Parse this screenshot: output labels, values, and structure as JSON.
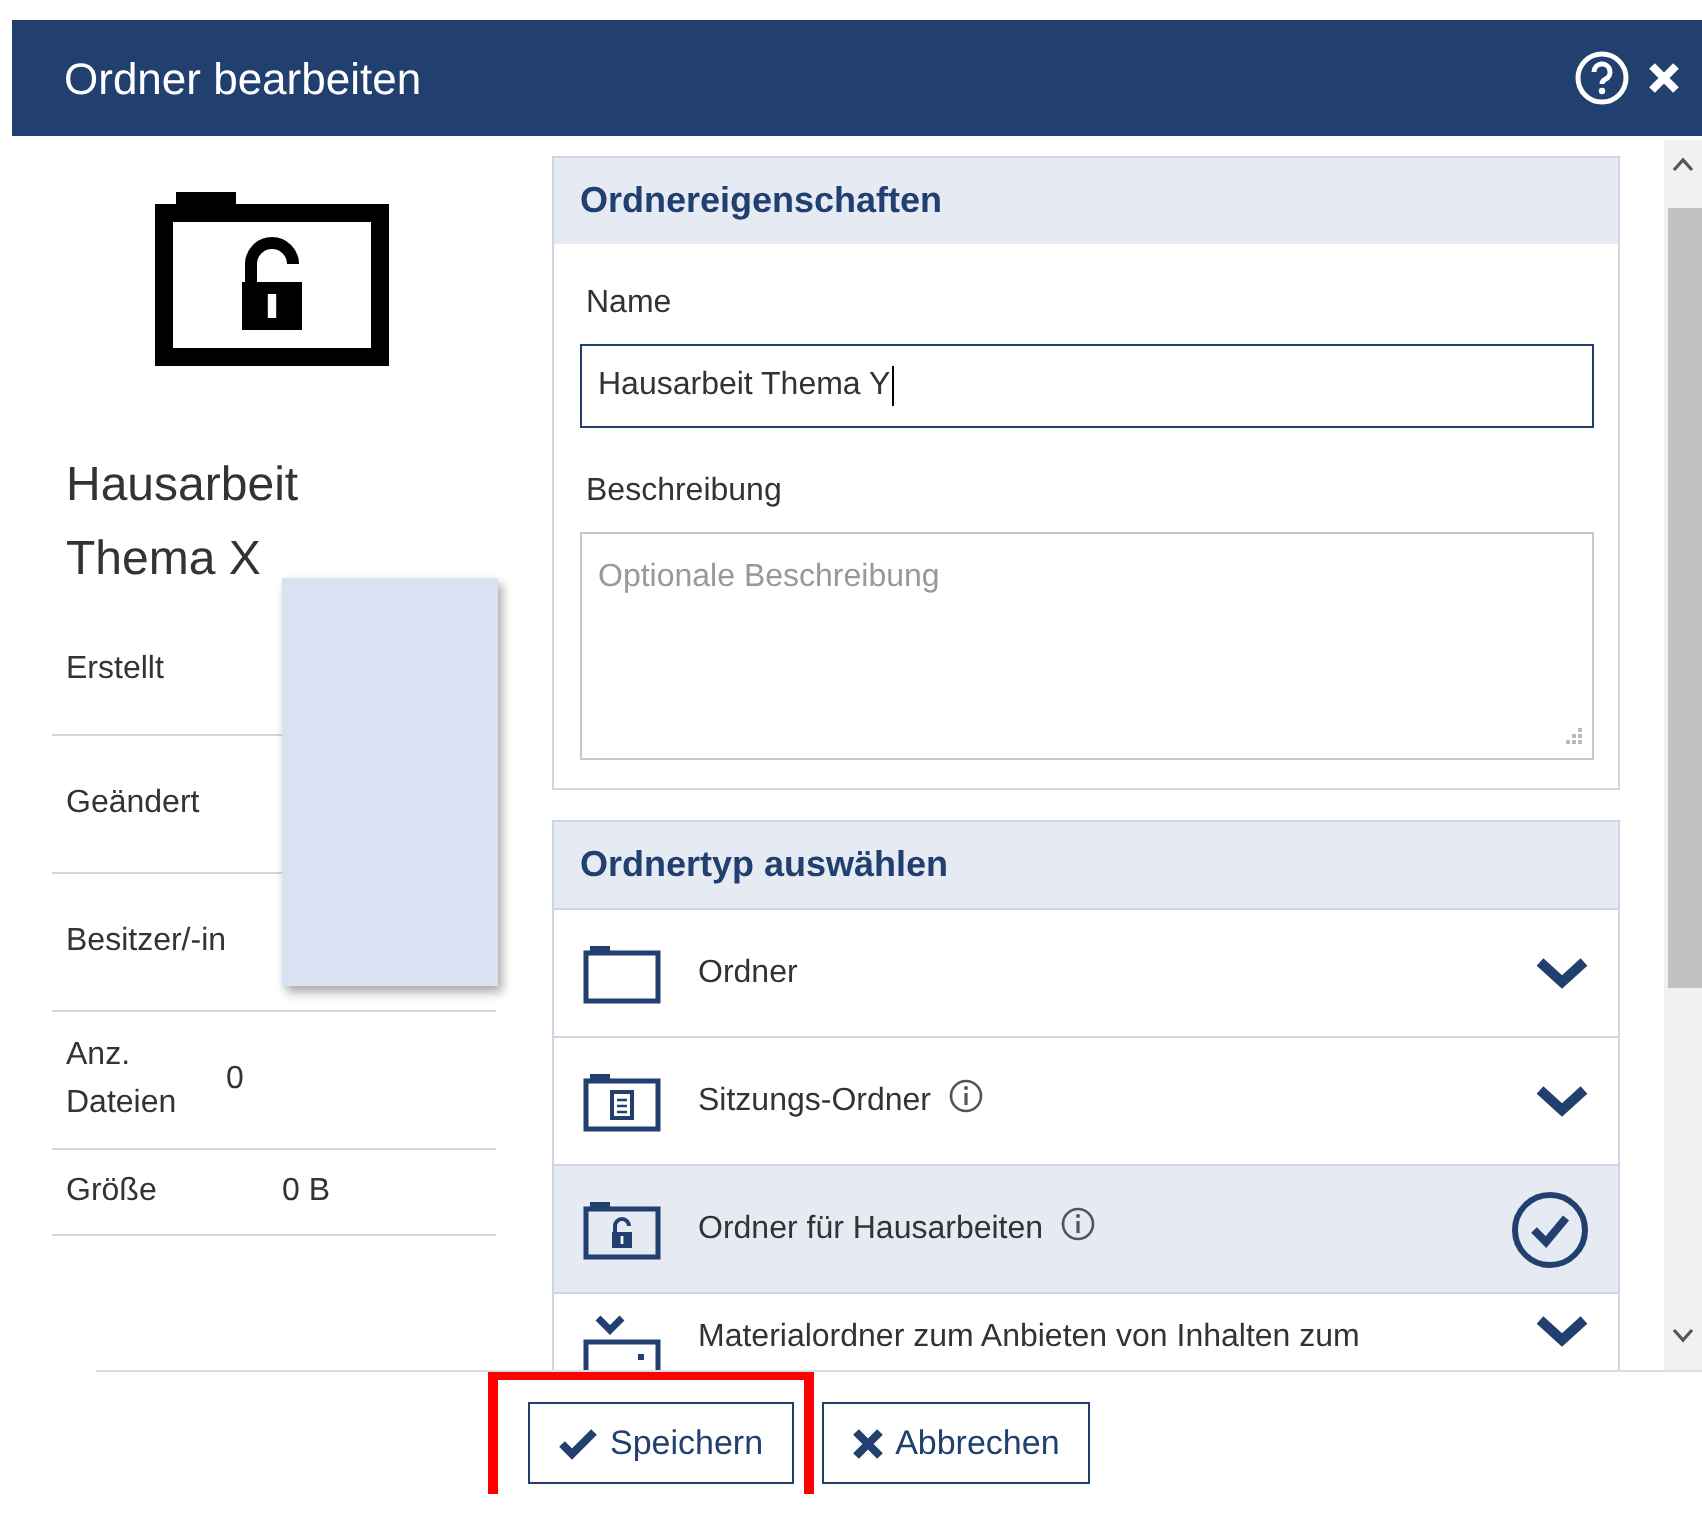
{
  "window": {
    "title": "Ordner bearbeiten"
  },
  "folder": {
    "name": "Hausarbeit Thema X"
  },
  "details": [
    {
      "label": "Erstellt",
      "redacted": true
    },
    {
      "label": "Geändert",
      "redacted": true
    },
    {
      "label": "Besitzer/-in",
      "redacted": true
    },
    {
      "label": "Anz. Dateien",
      "value": "0"
    },
    {
      "label": "Größe",
      "value": "0 B"
    }
  ],
  "properties": {
    "title": "Ordnereigenschaften",
    "name_label": "Name",
    "name_value": "Hausarbeit Thema Y",
    "description_label": "Beschreibung",
    "description_placeholder": "Optionale Beschreibung"
  },
  "folder_types": {
    "title": "Ordnertyp auswählen",
    "items": [
      {
        "label": "Ordner",
        "kind": "plain",
        "info": false,
        "selected": false
      },
      {
        "label": "Sitzungs-Ordner",
        "kind": "meeting",
        "info": true,
        "selected": false
      },
      {
        "label": "Ordner für Hausarbeiten",
        "kind": "locked",
        "info": true,
        "selected": true
      },
      {
        "label": "Materialordner zum Anbieten von Inhalten zum",
        "kind": "material",
        "info": false,
        "selected": false
      }
    ]
  },
  "buttons": [
    {
      "label": "Speichern",
      "kind": "save",
      "highlighted": true
    },
    {
      "label": "Abbrechen",
      "kind": "cancel",
      "highlighted": false
    }
  ]
}
